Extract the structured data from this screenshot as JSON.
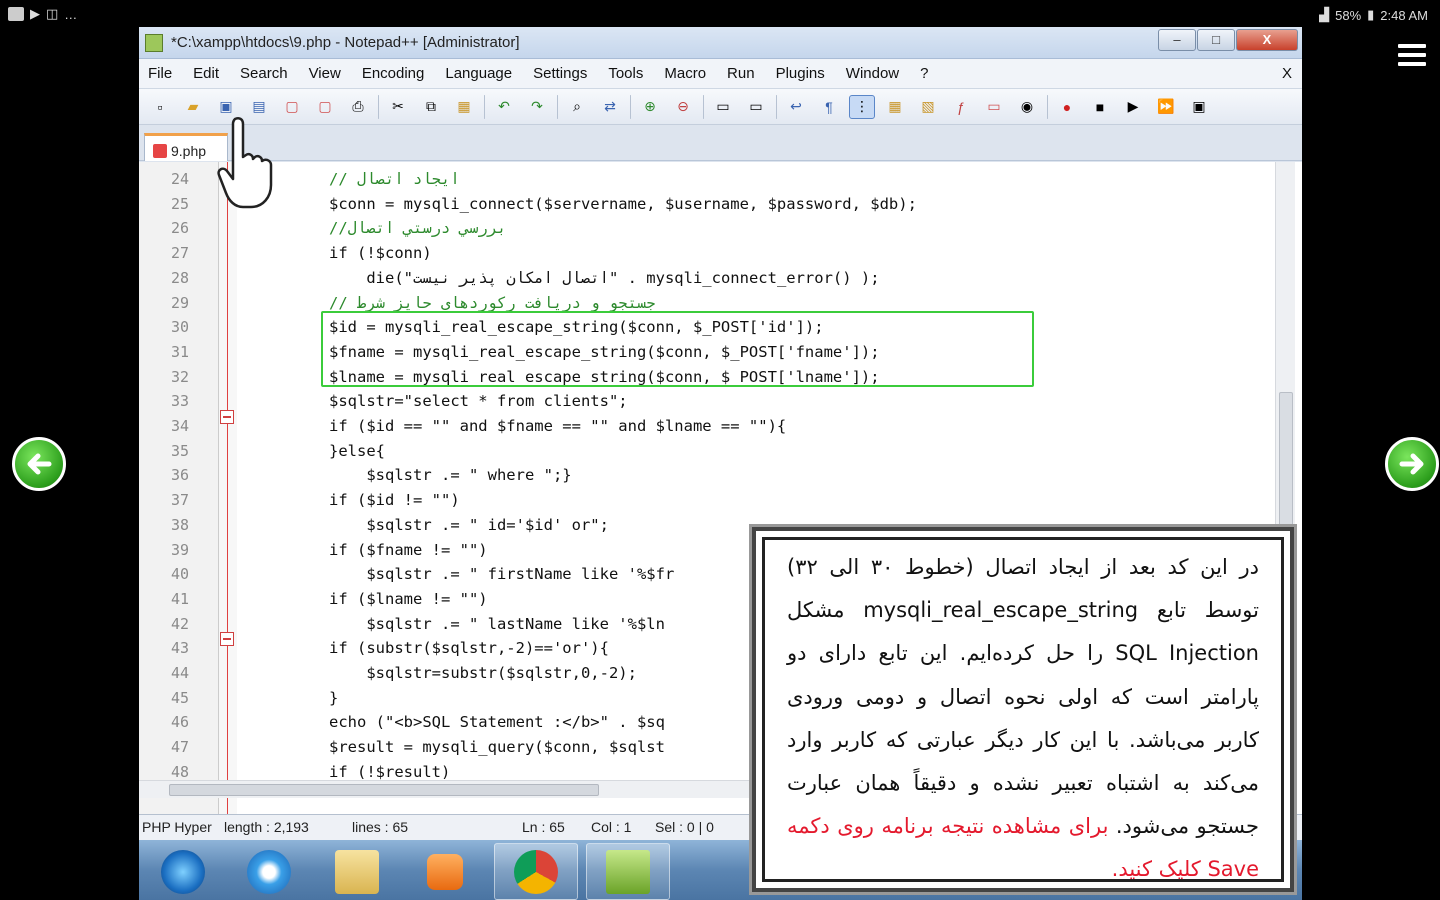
{
  "status_bar": {
    "battery": "58%",
    "time": "2:48 AM",
    "left_icons": [
      "gallery-icon",
      "play-store-icon",
      "clipboard-icon",
      "more-dots-icon"
    ]
  },
  "window": {
    "title": "*C:\\xampp\\htdocs\\9.php - Notepad++ [Administrator]",
    "controls": {
      "minimize": "–",
      "maximize": "□",
      "close": "X"
    }
  },
  "menu": {
    "items": [
      "File",
      "Edit",
      "Search",
      "View",
      "Encoding",
      "Language",
      "Settings",
      "Tools",
      "Macro",
      "Run",
      "Plugins",
      "Window",
      "?"
    ],
    "close": "X"
  },
  "tab": {
    "label": "9.php"
  },
  "editor": {
    "lines": [
      {
        "no": "24",
        "code": "// ایجاد اتصال"
      },
      {
        "no": "25",
        "code": "$conn = mysqli_connect($servername, $username, $password, $db);"
      },
      {
        "no": "26",
        "code": "//بررسي درستي اتصال"
      },
      {
        "no": "27",
        "code": "if (!$conn)"
      },
      {
        "no": "28",
        "code": "    die(\"اتصال امکان پذیر نیست\" . mysqli_connect_error() );"
      },
      {
        "no": "29",
        "code": "// جستجو و دریافت رکوردهای حایز شرط"
      },
      {
        "no": "30",
        "code": "$id = mysqli_real_escape_string($conn, $_POST['id']);"
      },
      {
        "no": "31",
        "code": "$fname = mysqli_real_escape_string($conn, $_POST['fname']);"
      },
      {
        "no": "32",
        "code": "$lname = mysqli_real_escape_string($conn, $_POST['lname']);"
      },
      {
        "no": "33",
        "code": "$sqlstr=\"select * from clients\";"
      },
      {
        "no": "34",
        "code": "if ($id == \"\" and $fname == \"\" and $lname == \"\"){"
      },
      {
        "no": "35",
        "code": "}else{"
      },
      {
        "no": "36",
        "code": "    $sqlstr .= \" where \";}"
      },
      {
        "no": "37",
        "code": "if ($id != \"\")"
      },
      {
        "no": "38",
        "code": "    $sqlstr .= \" id='$id' or\";"
      },
      {
        "no": "39",
        "code": "if ($fname != \"\")"
      },
      {
        "no": "40",
        "code": "    $sqlstr .= \" firstName like '%$fr"
      },
      {
        "no": "41",
        "code": "if ($lname != \"\")"
      },
      {
        "no": "42",
        "code": "    $sqlstr .= \" lastName like '%$ln"
      },
      {
        "no": "43",
        "code": "if (substr($sqlstr,-2)=='or'){"
      },
      {
        "no": "44",
        "code": "    $sqlstr=substr($sqlstr,0,-2);"
      },
      {
        "no": "45",
        "code": "}"
      },
      {
        "no": "46",
        "code": "echo (\"<b>SQL Statement :</b>\" . $sq"
      },
      {
        "no": "47",
        "code": "$result = mysqli_query($conn, $sqlst"
      },
      {
        "no": "48",
        "code": "if (!$result)"
      }
    ]
  },
  "statusline": {
    "type": "PHP Hyper",
    "length": "length : 2,193",
    "lines": "lines : 65",
    "ln": "Ln : 65",
    "col": "Col : 1",
    "sel": "Sel : 0 | 0"
  },
  "taskbar": {
    "items": [
      "windows-start-icon",
      "internet-explorer-icon",
      "file-explorer-icon",
      "media-player-icon",
      "chrome-icon",
      "notepad-plus-plus-icon"
    ]
  },
  "infobox": {
    "text_main": "در این کد بعد از ایجاد اتصال (خطوط ۳۰ الی ۳۲) توسط تابع mysqli_real_escape_string مشکل SQL Injection را حل کرده‌ایم. این تابع دارای دو پارامتر است که اولی نحوه اتصال و دومی ورودی کاربر می‌باشد. با این کار دیگر عبارتی که کاربر وارد می‌کند به اشتباه تعبیر نشده و دقیقاً همان عبارت جستجو می‌شود.",
    "text_red": " برای مشاهده نتیجه برنامه روی دکمه Save کلیک کنید."
  },
  "colors": {
    "highlight_box": "#3bcc3b",
    "accent_red": "#e4192d",
    "nav_green": "#2c9e1c"
  }
}
